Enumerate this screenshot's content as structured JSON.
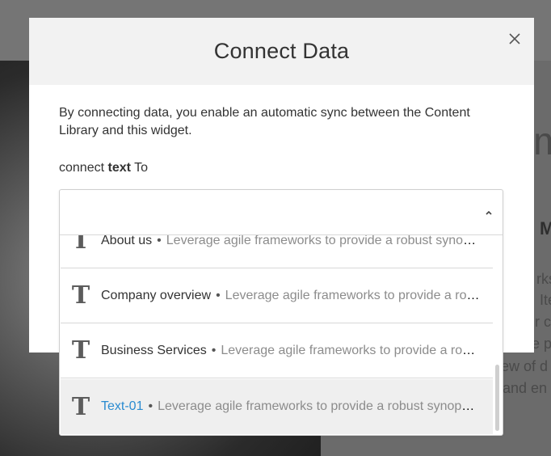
{
  "modal": {
    "title": "Connect Data",
    "description": "By connecting data, you enable an automatic sync between the Content Library and this widget.",
    "connect_prefix": "connect",
    "connect_bold": "text",
    "connect_suffix": "To"
  },
  "dropdown": {
    "selected_value": "",
    "items": [
      {
        "name": "About us",
        "description": "Leverage agile frameworks to provide a robust synopsis for high level overviews.",
        "icon": "text-type-icon"
      },
      {
        "name": "Company overview",
        "description": "Leverage agile frameworks to provide a robust synopsis for high level overviews.",
        "icon": "text-type-icon"
      },
      {
        "name": "Business Services",
        "description": "Leverage agile frameworks to provide a robust synopsis for high level overviews.",
        "icon": "text-type-icon"
      },
      {
        "name": "Text-01",
        "description": "Leverage agile frameworks to provide a robust synopsis for high level overviews.",
        "icon": "text-type-icon"
      }
    ],
    "selected_index": 3
  },
  "background": {
    "big_letter": "m",
    "bold_letter": "M",
    "lines": [
      "rks",
      "Ite",
      "r c",
      "e pr",
      "ew of d",
      "and en"
    ]
  },
  "colors": {
    "accent": "#2a8bd0",
    "overlay": "#6e6e6e",
    "header_bg": "#f2f2f2"
  }
}
